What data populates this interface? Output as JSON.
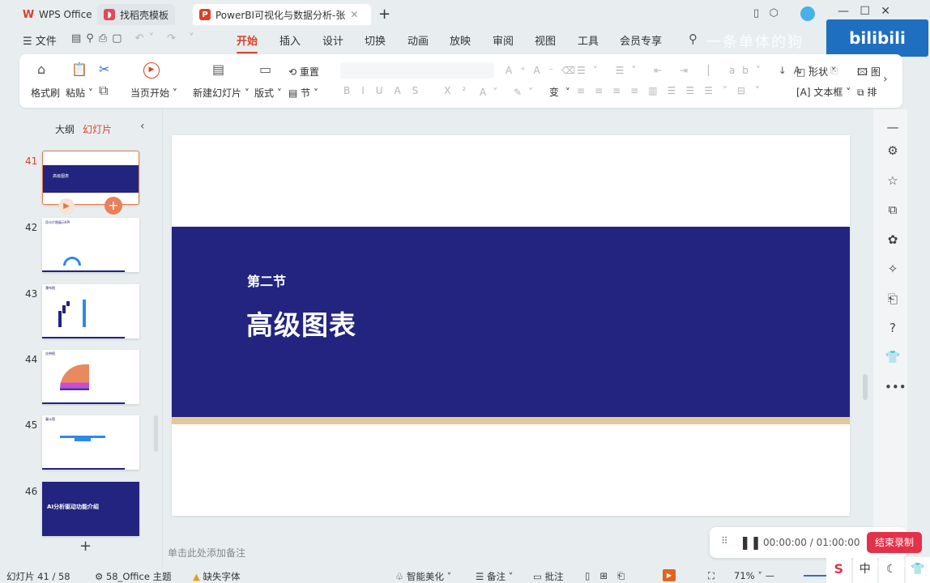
{
  "tabs": [
    {
      "label": "WPS Office",
      "icon": "wps-logo"
    },
    {
      "label": "找稻壳模板",
      "icon": "docer-logo"
    },
    {
      "label": "PowerBI可视化与数据分析-张",
      "icon": "ppt-logo"
    }
  ],
  "menu": {
    "file": "文件",
    "items": [
      "开始",
      "插入",
      "设计",
      "切换",
      "动画",
      "放映",
      "审阅",
      "视图",
      "工具",
      "会员专享"
    ],
    "active": "开始"
  },
  "watermark": "一条单体的狗",
  "ribbon": {
    "format_painter": "格式刷",
    "paste": "粘贴",
    "from_current": "当页开始",
    "new_slide": "新建幻灯片",
    "layout": "版式",
    "reset": "重置",
    "section": "节",
    "shape": "形状",
    "textbox": "文本框",
    "image": "图",
    "arrange": "排"
  },
  "panel": {
    "outline_tab": "大纲",
    "slides_tab": "幻灯片",
    "slides": [
      {
        "num": "41",
        "title": "高级图表",
        "selected": true
      },
      {
        "num": "42",
        "title": "用卡片图展示KPI"
      },
      {
        "num": "43",
        "title": "瀑布图"
      },
      {
        "num": "44",
        "title": "丝带图"
      },
      {
        "num": "45",
        "title": "漏斗图"
      },
      {
        "num": "46",
        "title": "AI分析驱动功能介绍"
      }
    ]
  },
  "slide": {
    "section": "第二节",
    "title": "高级图表",
    "colors": {
      "band": "#22247f",
      "stripe": "#e2c89a"
    }
  },
  "notes_placeholder": "单击此处添加备注",
  "recording": {
    "time": "00:00:00 / 01:00:00",
    "stop": "结束录制"
  },
  "status": {
    "slide_count": "幻灯片 41 / 58",
    "theme": "58_Office 主题",
    "missing_font": "缺失字体",
    "beautify": "智能美化",
    "notes": "备注",
    "comments": "批注",
    "zoom": "71%"
  },
  "ime": [
    "中"
  ]
}
